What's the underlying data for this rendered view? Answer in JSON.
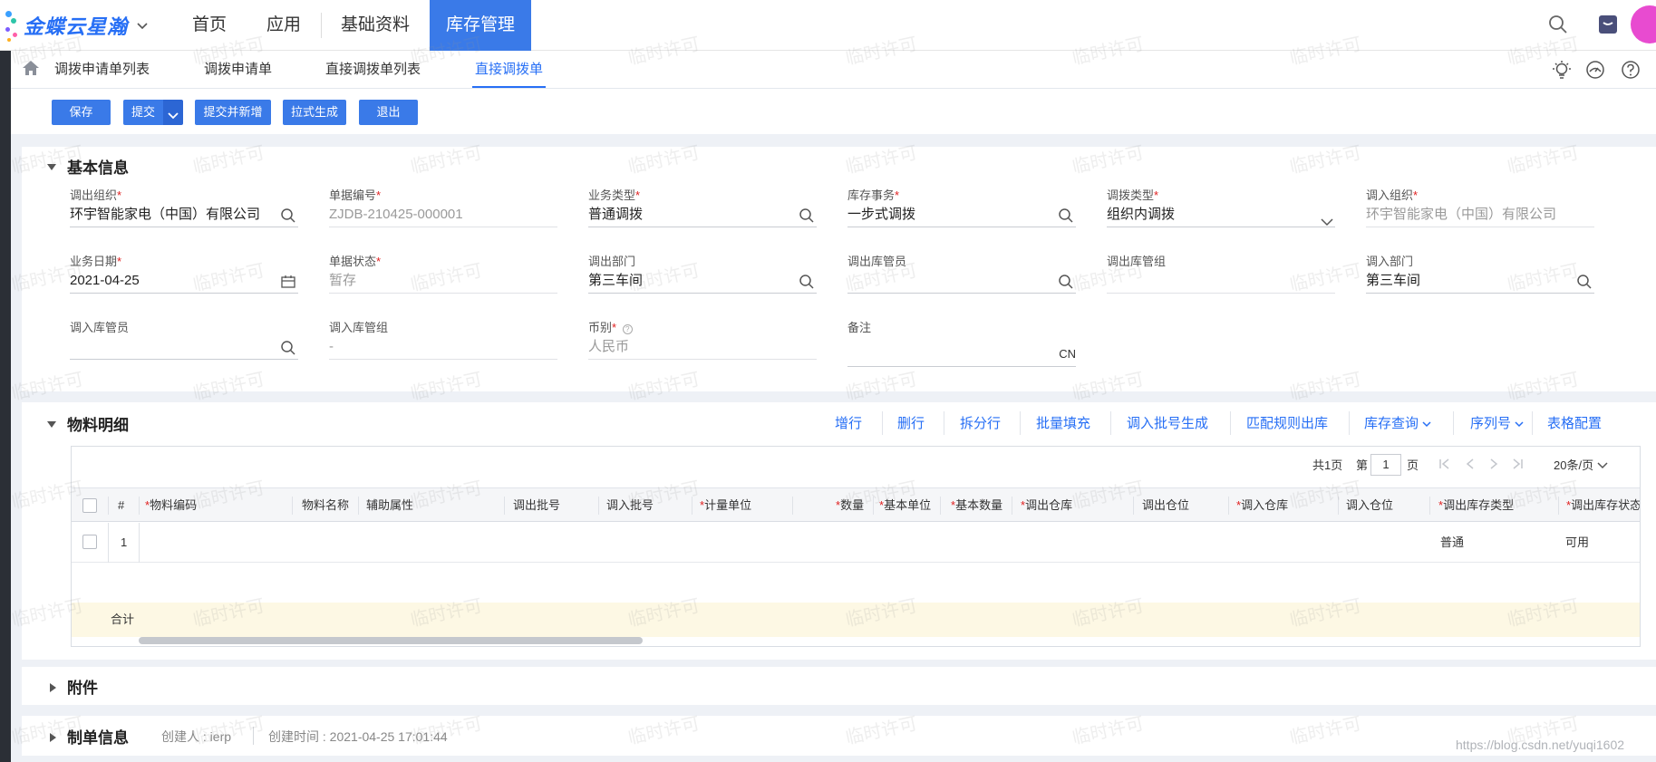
{
  "app": {
    "logo_text": "金蝶云星瀚",
    "brand_color": "#276ff5",
    "active_color": "#3a7ae8",
    "top_menu": [
      "首页",
      "应用",
      "基础资料",
      "库存管理"
    ]
  },
  "tabs": [
    "调拨申请单列表",
    "调拨申请单",
    "直接调拨单列表",
    "直接调拨单"
  ],
  "toolbar": {
    "save": "保存",
    "submit": "提交",
    "submit_new": "提交并新增",
    "pull_generate": "拉式生成",
    "exit": "退出"
  },
  "basic_info": {
    "title": "基本信息",
    "fields": [
      {
        "label": "调出组织",
        "required": true,
        "value": "环宇智能家电（中国）有限公司",
        "icon": "search-icon"
      },
      {
        "label": "单据编号",
        "required": true,
        "value": "ZJDB-210425-000001",
        "disabled": true
      },
      {
        "label": "业务类型",
        "required": true,
        "value": "普通调拨",
        "icon": "search-icon"
      },
      {
        "label": "库存事务",
        "required": true,
        "value": "一步式调拨",
        "icon": "search-icon"
      },
      {
        "label": "调拨类型",
        "required": true,
        "value": "组织内调拨",
        "icon": "chevron-down-icon"
      },
      {
        "label": "调入组织",
        "required": true,
        "value": "环宇智能家电（中国）有限公司",
        "disabled": true
      },
      {
        "label": "业务日期",
        "required": true,
        "value": "2021-04-25",
        "icon": "calendar-icon"
      },
      {
        "label": "单据状态",
        "required": true,
        "value": "暂存",
        "disabled": true
      },
      {
        "label": "调出部门",
        "required": false,
        "value": "第三车间",
        "icon": "search-icon"
      },
      {
        "label": "调出库管员",
        "required": false,
        "value": "",
        "icon": "search-icon"
      },
      {
        "label": "调出库管组",
        "required": false,
        "value": "",
        "disabled": true
      },
      {
        "label": "调入部门",
        "required": false,
        "value": "第三车间",
        "icon": "search-icon"
      },
      {
        "label": "调入库管员",
        "required": false,
        "value": "",
        "icon": "search-icon"
      },
      {
        "label": "调入库管组",
        "required": false,
        "value": "-",
        "disabled": true
      },
      {
        "label": "币别",
        "required": true,
        "value": "人民币",
        "disabled": true,
        "help": true
      },
      {
        "label": "备注",
        "required": false,
        "value": "",
        "suffix": "CN"
      }
    ]
  },
  "material": {
    "title": "物料明细",
    "actions": [
      "增行",
      "删行",
      "拆分行",
      "批量填充",
      "调入批号生成",
      "匹配规则出库",
      "库存查询",
      "序列号",
      "表格配置"
    ],
    "pager": {
      "total": "共1页",
      "prefix": "第",
      "page": "1",
      "suffix": "页",
      "page_size": "20条/页"
    },
    "columns": [
      {
        "label": "#",
        "required": false
      },
      {
        "label": "物料编码",
        "required": true
      },
      {
        "label": "物料名称",
        "required": false
      },
      {
        "label": "辅助属性",
        "required": false
      },
      {
        "label": "调出批号",
        "required": false
      },
      {
        "label": "调入批号",
        "required": false
      },
      {
        "label": "计量单位",
        "required": true
      },
      {
        "label": "数量",
        "required": true
      },
      {
        "label": "基本单位",
        "required": true
      },
      {
        "label": "基本数量",
        "required": true
      },
      {
        "label": "调出仓库",
        "required": true
      },
      {
        "label": "调出仓位",
        "required": false
      },
      {
        "label": "调入仓库",
        "required": true
      },
      {
        "label": "调入仓位",
        "required": false
      },
      {
        "label": "调出库存类型",
        "required": true
      },
      {
        "label": "调出库存状态",
        "required": true
      }
    ],
    "rows": [
      {
        "no": "1",
        "out_stock_type": "普通",
        "out_stock_status": "可用"
      }
    ],
    "summary_label": "合计"
  },
  "attachments": {
    "title": "附件"
  },
  "doc_info": {
    "title": "制单信息",
    "creator": "创建人 : ierp",
    "created_time": "创建时间 : 2021-04-25 17:01:44"
  },
  "watermark": "临时许可",
  "credit": "https://blog.csdn.net/yuqi1602"
}
